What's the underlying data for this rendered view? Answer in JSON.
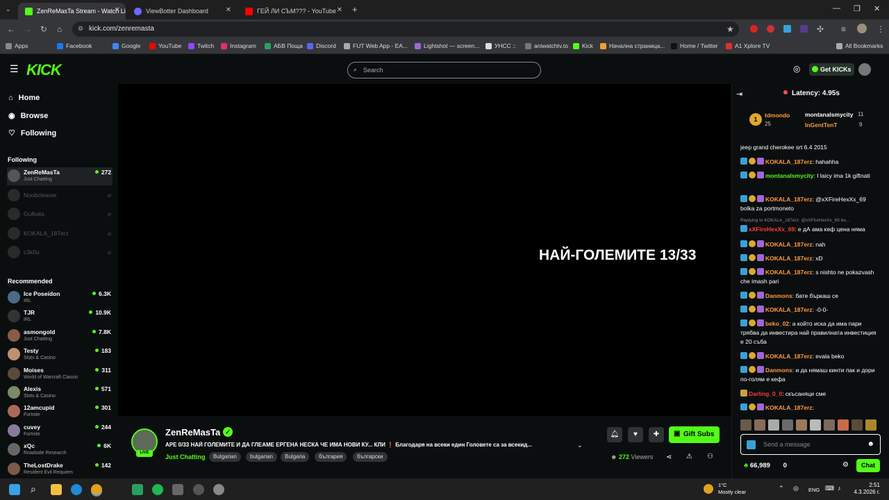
{
  "browser": {
    "tabs": [
      {
        "title": "ZenReMasTa Stream - Watch Li",
        "favicon_color": "#53fc18"
      },
      {
        "title": "ViewBotter Dashboard",
        "favicon_color": "#6b6bff"
      },
      {
        "title": "ГЕЙ ЛИ СЪМ??? - YouTube",
        "favicon_color": "#ff0000"
      }
    ],
    "url": "kick.com/zenremasta",
    "bookmarks": [
      "Apps",
      "Facebook",
      "Google",
      "YouTube",
      "Twitch",
      "Instagram",
      "АБВ Поща",
      "Discord",
      "FUT Web App - EA...",
      "Lightshot — screen...",
      "УНСС :: ",
      "aniwatchtv.to",
      "Kick",
      "Начална страница...",
      "Home / Twitter",
      "A1 Xplore TV",
      "All Bookmarks"
    ]
  },
  "header": {
    "logo": "KICK",
    "search_placeholder": "Search",
    "get_kicks": "Get KICKs"
  },
  "sidebar": {
    "nav": [
      "Home",
      "Browse",
      "Following"
    ],
    "following_title": "Following",
    "following": [
      {
        "name": "ZenReMasTa",
        "category": "Just Chatting",
        "viewers": "272",
        "live": true
      },
      {
        "name": "Noobcleaver",
        "live": false
      },
      {
        "name": "Gufkata",
        "live": false
      },
      {
        "name": "KOKALA_187erz",
        "live": false
      },
      {
        "name": "c3k0u",
        "live": false
      }
    ],
    "recommended_title": "Recommended",
    "recommended": [
      {
        "name": "Ice Poseidon",
        "category": "IRL",
        "viewers": "6.3K"
      },
      {
        "name": "TJR",
        "category": "IRL",
        "viewers": "10.9K"
      },
      {
        "name": "asmongold",
        "category": "Just Chatting",
        "viewers": "7.8K"
      },
      {
        "name": "Testy",
        "category": "Slots & Casino",
        "viewers": "183"
      },
      {
        "name": "Moises",
        "category": "World of Warcraft Classic",
        "viewers": "311"
      },
      {
        "name": "Alexis",
        "category": "Slots & Casino",
        "viewers": "571"
      },
      {
        "name": "12amcupid",
        "category": "Fortnite",
        "viewers": "301"
      },
      {
        "name": "cuvey",
        "category": "Fortnite",
        "viewers": "244"
      },
      {
        "name": "xQc",
        "category": "Roadside Research",
        "viewers": "6K"
      },
      {
        "name": "TheLostDrake",
        "category": "Resident Evil Requiem",
        "viewers": "142"
      }
    ]
  },
  "video": {
    "overlay_text": "НАЙ-ГОЛЕМИТЕ 13/33"
  },
  "stream": {
    "streamer": "ZenReMasTa",
    "live_badge": "LIVE",
    "title": "APE 0/33 НАЙ ГОЛЕМИТЕ И ДА ГЛЕАМЕ ЕРГЕНА НЕСКА ЧЕ ИМА НОВИ КУ... КЛИ ❗ Благодаря на всеки един Головете са за всекид...",
    "category": "Just Chatting",
    "tags": [
      "Bulgarian",
      "bulgarian",
      "Bulgaria",
      "българия",
      "български"
    ],
    "gift_subs": "Gift Subs",
    "viewers": "272",
    "viewers_label": "Viewers"
  },
  "chat": {
    "latency": "Latency: 4.95s",
    "leaderboard": [
      {
        "name": "tdmondo",
        "count": "25"
      },
      {
        "name": "montanalsmycity",
        "count": "11"
      },
      {
        "name": "InGentTenT",
        "count": "9"
      }
    ],
    "messages": [
      {
        "user": "",
        "color": "#ffffff",
        "text": "jeep grand cherokee srt 6.4 2015"
      },
      {
        "user": "KOKALA_187erz",
        "color": "#ff9a3c",
        "text": ": hahahha"
      },
      {
        "user": "montanalsmycity",
        "color": "#53fc18",
        "text": ": I laicy ima 1k giftnati"
      },
      {
        "user": "KOKALA_187erz",
        "color": "#ff9a3c",
        "text": ": @xXFireHexXx_69 bolka za portmoneto"
      },
      {
        "user": "xXFireHexXx_69",
        "color": "#ff3b3b",
        "text": ": е дА ама кеф цена няма"
      },
      {
        "user": "KOKALA_187erz",
        "color": "#ff9a3c",
        "text": ": nah"
      },
      {
        "user": "KOKALA_187erz",
        "color": "#ff9a3c",
        "text": ": xD"
      },
      {
        "user": "KOKALA_187erz",
        "color": "#ff9a3c",
        "text": ": s nishto ne pokazvash che imash pari"
      },
      {
        "user": "Danmons",
        "color": "#ff9a3c",
        "text": ": бате бъркаш се"
      },
      {
        "user": "KOKALA_187erz",
        "color": "#ff9a3c",
        "text": ": -0-0-"
      },
      {
        "user": "beko_02",
        "color": "#ff9a3c",
        "text": ": а който иска да има пари трябва да инвестира най правилната инвестиция е 20 съба"
      },
      {
        "user": "KOKALA_187erz",
        "color": "#ff9a3c",
        "text": ": evala beko"
      },
      {
        "user": "Danmons",
        "color": "#ff9a3c",
        "text": ": и да нямаш кинти пак и дори по-голям е кефа"
      },
      {
        "user": "Darling_0_0",
        "color": "#ff3b3b",
        "text": ": скъсаняци сме"
      },
      {
        "user": "KOKALA_187erz",
        "color": "#ff9a3c",
        "text": ":"
      }
    ],
    "reply_context": "Replying to KOKALA_187erz: @xXFireHexXx_69 bo...",
    "input_placeholder": "Send a message",
    "points": "66,989",
    "points2": "0",
    "chat_button": "Chat"
  },
  "taskbar": {
    "temp": "1°C",
    "weather": "Mostly clear",
    "lang": "ENG",
    "time": "2:51",
    "date": "4.3.2026 г."
  }
}
